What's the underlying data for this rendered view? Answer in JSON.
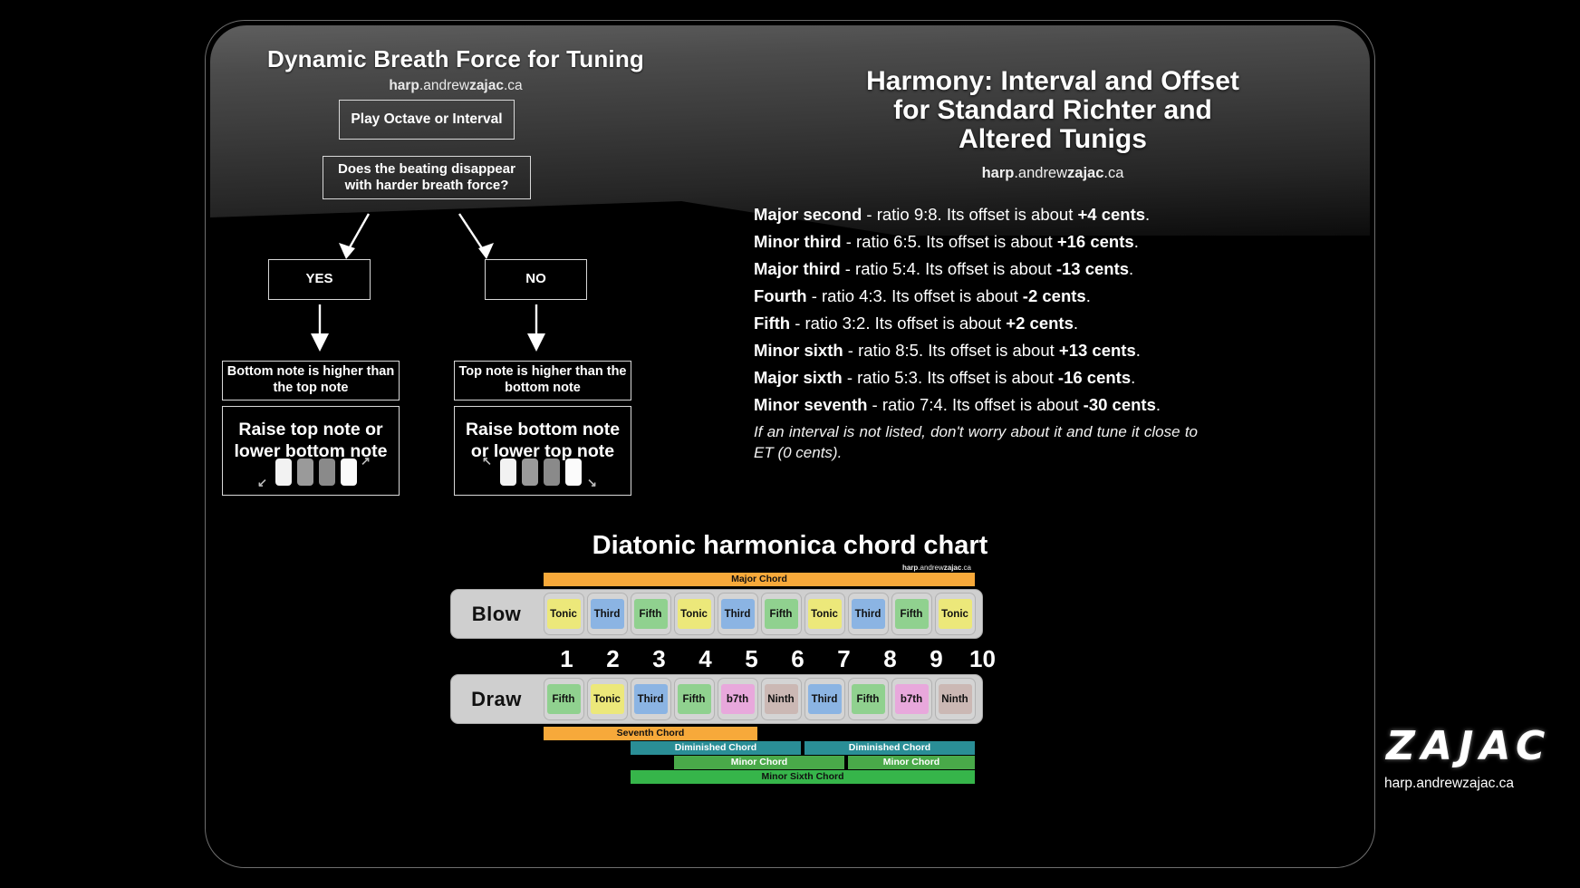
{
  "flowchart": {
    "title": "Dynamic Breath Force for Tuning",
    "credit_parts": [
      "harp",
      ".andrew",
      "zajac",
      ".ca"
    ],
    "start_box": "Play Octave or Interval",
    "question_box": "Does the beating disappear with harder breath force?",
    "yes_label": "YES",
    "no_label": "NO",
    "yes_result": "Bottom note is higher than the top note",
    "no_result": "Top note is higher than the bottom note",
    "yes_action": "Raise top note or lower bottom note",
    "no_action": "Raise bottom note or lower top note"
  },
  "harmony": {
    "title": "Harmony: Interval and Offset for Standard Richter and Altered Tunigs",
    "title_lines": [
      "Harmony: Interval and Offset",
      "for Standard Richter and",
      "Altered Tunigs"
    ],
    "credit_parts": [
      "harp",
      ".andrew",
      "zajac",
      ".ca"
    ],
    "intervals": [
      {
        "name": "Major second",
        "ratio": "9:8",
        "cents": "+4 cents"
      },
      {
        "name": "Minor third",
        "ratio": "6:5",
        "cents": "+16 cents"
      },
      {
        "name": "Major third",
        "ratio": "5:4",
        "cents": "-13 cents"
      },
      {
        "name": "Fourth",
        "ratio": "4:3",
        "cents": "-2 cents"
      },
      {
        "name": "Fifth",
        "ratio": "3:2",
        "cents": "+2 cents"
      },
      {
        "name": "Minor sixth",
        "ratio": "8:5",
        "cents": "+13 cents"
      },
      {
        "name": "Major sixth ",
        "ratio": "5:3",
        "cents": "-16 cents"
      },
      {
        "name": "Minor seventh",
        "ratio": "7:4",
        "cents": "-30 cents"
      }
    ],
    "mid_text": " - ratio ",
    "mid_text2": ". Its offset is about ",
    "end_text": ".",
    "note": "If an interval is not listed, don't worry about it and tune it close to ET (0 cents)."
  },
  "chord_chart": {
    "title": "Diatonic harmonica chord chart",
    "credit_parts": [
      "harp",
      ".andrew",
      "zajac",
      ".ca"
    ],
    "blow_label": "Blow",
    "draw_label": "Draw",
    "holes": [
      "1",
      "2",
      "3",
      "4",
      "5",
      "6",
      "7",
      "8",
      "9",
      "10"
    ],
    "blow_notes": [
      "Tonic",
      "Third",
      "Fifth",
      "Tonic",
      "Third",
      "Fifth",
      "Tonic",
      "Third",
      "Fifth",
      "Tonic"
    ],
    "draw_notes": [
      "Fifth",
      "Tonic",
      "Third",
      "Fifth",
      "b7th",
      "Ninth",
      "Third",
      "Fifth",
      "b7th",
      "Ninth"
    ],
    "note_colors": {
      "Tonic": "#ece87a",
      "Third": "#8bb4e3",
      "Fifth": "#90d18f",
      "b7th": "#e8a8dc",
      "Ninth": "#cbb8b4"
    },
    "top_bands": [
      {
        "label": "Major Chord",
        "start": 1,
        "end": 10,
        "color": "#f7a93a",
        "text": "dark"
      }
    ],
    "bottom_bands": [
      [
        {
          "label": "Seventh Chord",
          "start": 1,
          "end": 5,
          "color": "#f7a93a",
          "text": "dark"
        }
      ],
      [
        {
          "label": "Diminished Chord",
          "start": 3,
          "end": 6,
          "color": "#2a8e96",
          "text": "light"
        },
        {
          "label": "Diminished Chord",
          "start": 7,
          "end": 10,
          "color": "#2a8e96",
          "text": "light"
        }
      ],
      [
        {
          "label": "Minor Chord",
          "start": 4,
          "end": 7,
          "color": "#49a949",
          "text": "light"
        },
        {
          "label": "Minor Chord",
          "start": 8,
          "end": 10,
          "color": "#49a949",
          "text": "light"
        }
      ],
      [
        {
          "label": "Minor Sixth Chord",
          "start": 3,
          "end": 10,
          "color": "#36b54a",
          "text": "dark"
        }
      ]
    ]
  },
  "branding": {
    "logo": "ZAJAC",
    "url": "harp.andrewzajac.ca"
  }
}
